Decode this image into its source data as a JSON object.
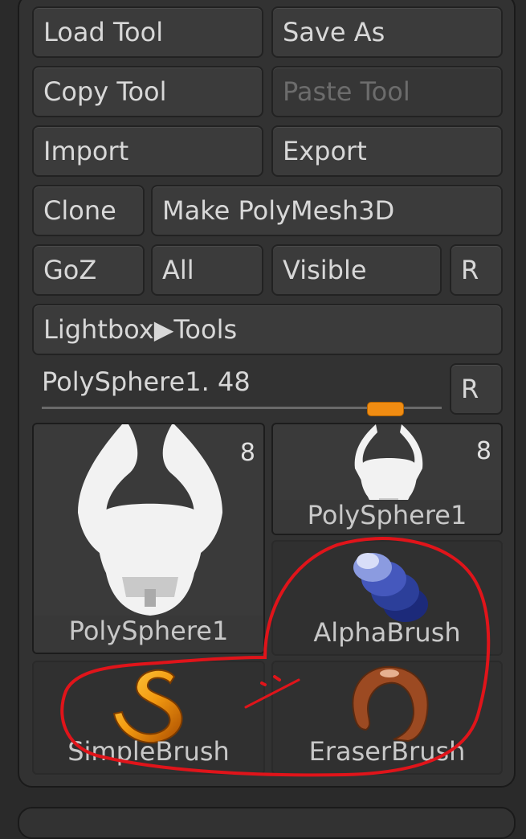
{
  "tool_palette": {
    "buttons": {
      "load_tool": "Load Tool",
      "save_as": "Save As",
      "copy_tool": "Copy Tool",
      "paste_tool": "Paste Tool",
      "import": "Import",
      "export": "Export",
      "clone": "Clone",
      "make_polymesh3d": "Make PolyMesh3D",
      "goz": "GoZ",
      "all": "All",
      "visible": "Visible",
      "r_goz": "R",
      "lightbox_tools": "Lightbox▶Tools",
      "r_slider": "R"
    },
    "slider": {
      "label": "PolySphere1. 48",
      "value_fraction": 0.86
    },
    "tools": [
      {
        "name": "PolySphere1",
        "count": "8",
        "icon": "horned-mask-icon"
      },
      {
        "name": "PolySphere1",
        "count": "8",
        "icon": "horned-mask-icon"
      },
      {
        "name": "AlphaBrush",
        "icon": "alpha-brush-icon"
      },
      {
        "name": "SimpleBrush",
        "icon": "simple-brush-icon"
      },
      {
        "name": "EraserBrush",
        "icon": "eraser-brush-icon"
      }
    ]
  },
  "annotation": {
    "color": "#e0141a"
  },
  "colors": {
    "accent": "#f08c12",
    "panel": "#323232",
    "button": "#3b3b3b"
  }
}
